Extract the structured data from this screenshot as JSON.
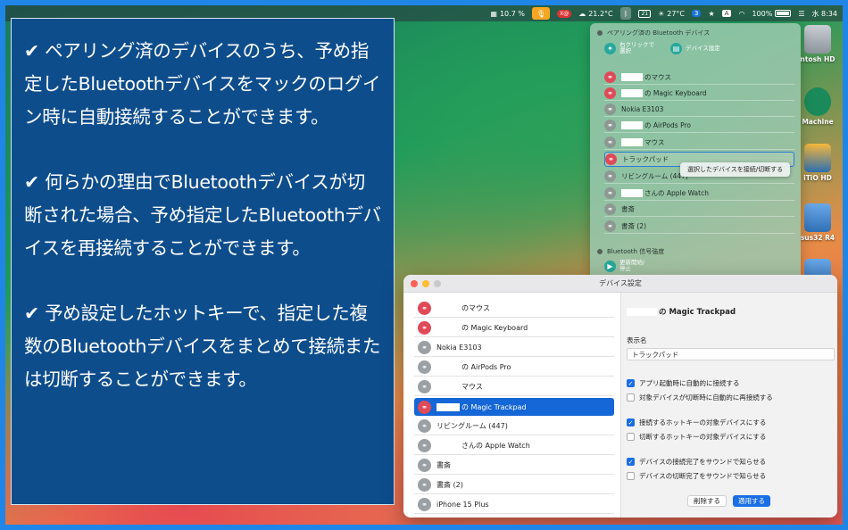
{
  "menubar": {
    "cpu": "10.7 %",
    "badge_text": "X@",
    "weather": "21.2°C",
    "calendar": "21",
    "temp": "27°C",
    "num_badge": "3",
    "input_source": "A",
    "battery": "100%",
    "clock": "水 8:34"
  },
  "info": {
    "para1": "✔ ペアリング済のデバイスのうち、予め指定したBluetoothデバイスをマックのログイン時に自動接続することができます。",
    "para2": "✔ 何らかの理由でBluetoothデバイスが切断された場合、予め指定したBluetoothデバイスを再接続することができます。",
    "para3": "✔ 予め設定したホットキーで、指定した複数のBluetoothデバイスをまとめて接続または切断することができます。"
  },
  "desktop": {
    "icons": [
      {
        "label": "ntosh HD"
      },
      {
        "label": "Machine"
      },
      {
        "label": "iTiO HD"
      },
      {
        "label": "sus32 R4"
      },
      {
        "label": ""
      }
    ]
  },
  "bt_menu": {
    "paired_header": "ペアリング済の Bluetooth デバイス",
    "quick1": "右クリックで\n選択",
    "quick2": "デバイス設定",
    "items": [
      {
        "label": "のマウス",
        "redacted": true,
        "connected": true
      },
      {
        "label": "の Magic Keyboard",
        "redacted": true,
        "connected": true
      },
      {
        "label": "Nokia E3103",
        "redacted": false,
        "connected": false
      },
      {
        "label": "の AirPods Pro",
        "redacted": true,
        "connected": false
      },
      {
        "label": "マウス",
        "redacted": true,
        "connected": false
      },
      {
        "label": "トラックパッド",
        "redacted": false,
        "connected": true
      },
      {
        "label": "リビングルーム (447)",
        "redacted": false,
        "connected": false
      },
      {
        "label": "さんの Apple Watch",
        "redacted": true,
        "connected": false
      },
      {
        "label": "書斎",
        "redacted": false,
        "connected": false
      },
      {
        "label": "書斎 (2)",
        "redacted": false,
        "connected": false
      }
    ],
    "tooltip": "選択したデバイスを接続/切断する",
    "signal_header": "Bluetooth 信号強度",
    "signal_item": "更新開始/\n停止"
  },
  "settings": {
    "title": "デバイス設定",
    "devices": [
      {
        "label": "のマウス",
        "connected": true
      },
      {
        "label": "の Magic Keyboard",
        "connected": true
      },
      {
        "label": "Nokia E3103",
        "connected": false
      },
      {
        "label": "の AirPods Pro",
        "connected": false
      },
      {
        "label": "マウス",
        "connected": false
      },
      {
        "label": "の Magic Trackpad",
        "connected": true
      },
      {
        "label": "リビングルーム (447)",
        "connected": false
      },
      {
        "label": "さんの Apple Watch",
        "connected": false
      },
      {
        "label": "書斎",
        "connected": false
      },
      {
        "label": "書斎 (2)",
        "connected": false
      },
      {
        "label": "iPhone 15 Plus",
        "connected": false
      }
    ],
    "selected_index": 5,
    "detail_title": "の Magic Trackpad",
    "display_name_label": "表示名",
    "display_name_value": "トラックパッド",
    "options": [
      {
        "label": "アプリ起動時に自動的に接続する",
        "checked": true
      },
      {
        "label": "対象デバイスが切断時に自動的に再接続する",
        "checked": false
      },
      {
        "label": "接続するホットキーの対象デバイスにする",
        "checked": true
      },
      {
        "label": "切断するホットキーの対象デバイスにする",
        "checked": false
      },
      {
        "label": "デバイスの接続完了をサウンドで知らせる",
        "checked": true
      },
      {
        "label": "デバイスの切断完了をサウンドで知らせる",
        "checked": false
      }
    ],
    "delete_label": "削除する",
    "apply_label": "適用する"
  }
}
